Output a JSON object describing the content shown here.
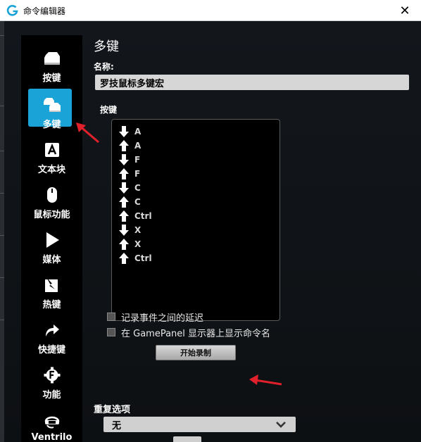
{
  "window": {
    "title": "命令编辑器",
    "close_glyph": "✕"
  },
  "sidebar": {
    "items": [
      {
        "label": "按键",
        "icon": "key-icon"
      },
      {
        "label": "多键",
        "icon": "multikey-icon",
        "active": true
      },
      {
        "label": "文本块",
        "icon": "text-block-icon"
      },
      {
        "label": "鼠标功能",
        "icon": "mouse-icon"
      },
      {
        "label": "媒体",
        "icon": "play-icon"
      },
      {
        "label": "热键",
        "icon": "hotkey-icon"
      },
      {
        "label": "快捷键",
        "icon": "shortcut-icon"
      },
      {
        "label": "功能",
        "icon": "function-icon"
      },
      {
        "label": "Ventrilo",
        "icon": "headset-icon"
      }
    ]
  },
  "main": {
    "heading": "多键",
    "name_label": "名称:",
    "name_value": "罗技鼠标多键宏",
    "keys_label": "按键",
    "keys": [
      {
        "dir": "down",
        "key": "A"
      },
      {
        "dir": "up",
        "key": "A"
      },
      {
        "dir": "down",
        "key": "F"
      },
      {
        "dir": "up",
        "key": "F"
      },
      {
        "dir": "down",
        "key": "C"
      },
      {
        "dir": "up",
        "key": "C"
      },
      {
        "dir": "down",
        "key": "Ctrl"
      },
      {
        "dir": "down",
        "key": "X"
      },
      {
        "dir": "up",
        "key": "X"
      },
      {
        "dir": "up",
        "key": "Ctrl"
      }
    ],
    "checkbox_delay": "记录事件之间的延迟",
    "checkbox_gamepanel": "在 GamePanel 显示器上显示命令名",
    "record_button": "开始录制",
    "repeat_label": "重复选项",
    "repeat_value": "无"
  },
  "colors": {
    "accent": "#1aa3d6",
    "annotation": "#e0202a"
  }
}
